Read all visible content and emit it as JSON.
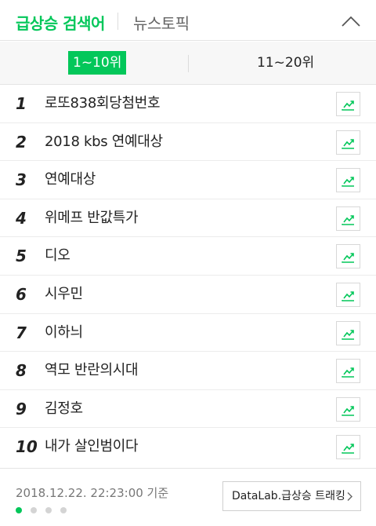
{
  "header": {
    "tab_trending": "급상승 검색어",
    "tab_news": "뉴스토픽"
  },
  "range_tabs": {
    "active": "1~10위",
    "inactive": "11~20위"
  },
  "ranks": [
    {
      "rank": "1",
      "keyword": "로또838회당첨번호"
    },
    {
      "rank": "2",
      "keyword": "2018 kbs 연예대상"
    },
    {
      "rank": "3",
      "keyword": "연예대상"
    },
    {
      "rank": "4",
      "keyword": "위메프 반값특가"
    },
    {
      "rank": "5",
      "keyword": "디오"
    },
    {
      "rank": "6",
      "keyword": "시우민"
    },
    {
      "rank": "7",
      "keyword": "이하늬"
    },
    {
      "rank": "8",
      "keyword": "역모 반란의시대"
    },
    {
      "rank": "9",
      "keyword": "김정호"
    },
    {
      "rank": "10",
      "keyword": "내가 살인범이다"
    }
  ],
  "footer": {
    "timestamp": "2018.12.22. 22:23:00 기준",
    "datalab_label": "DataLab.급상승 트래킹",
    "page_dots_total": 4,
    "page_dots_active": 1
  },
  "colors": {
    "accent": "#03c75a",
    "text": "#222222",
    "muted": "#777777"
  },
  "icons": {
    "collapse": "chevron-up-icon",
    "trend": "trend-chart-icon",
    "datalab_arrow": "chevron-right-icon"
  }
}
